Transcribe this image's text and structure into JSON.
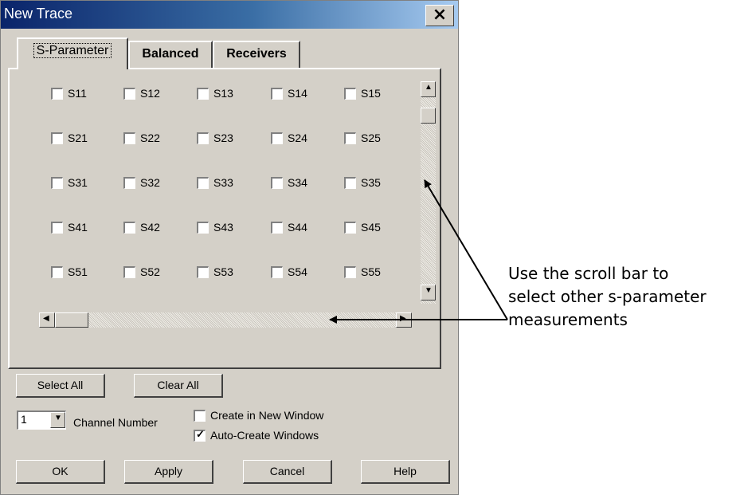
{
  "window": {
    "title": "New Trace",
    "close_glyph": "×"
  },
  "tabs": [
    {
      "label": "S-Parameter",
      "active": true
    },
    {
      "label": "Balanced",
      "active": false
    },
    {
      "label": "Receivers",
      "active": false
    }
  ],
  "sparams": [
    [
      "S11",
      "S12",
      "S13",
      "S14",
      "S15"
    ],
    [
      "S21",
      "S22",
      "S23",
      "S24",
      "S25"
    ],
    [
      "S31",
      "S32",
      "S33",
      "S34",
      "S35"
    ],
    [
      "S41",
      "S42",
      "S43",
      "S44",
      "S45"
    ],
    [
      "S51",
      "S52",
      "S53",
      "S54",
      "S55"
    ]
  ],
  "scroll": {
    "up_icon": "▲",
    "down_icon": "▼",
    "left_icon": "◀",
    "right_icon": "▶"
  },
  "buttons": {
    "select_all": "Select All",
    "clear_all": "Clear All",
    "ok": "OK",
    "apply": "Apply",
    "cancel": "Cancel",
    "help": "Help"
  },
  "channel": {
    "value": "1",
    "label": "Channel Number"
  },
  "options": {
    "create_new_window": {
      "label": "Create in New Window",
      "checked": false
    },
    "auto_create_windows": {
      "label": "Auto-Create Windows",
      "checked": true
    }
  },
  "annotation": {
    "line1": "Use the scroll bar to",
    "line2": "select other s-parameter",
    "line3": "measurements"
  }
}
